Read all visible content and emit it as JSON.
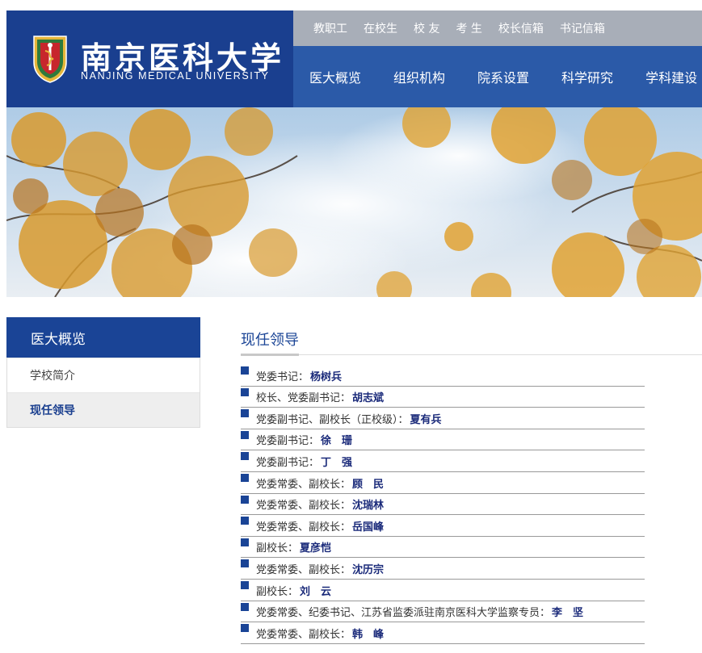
{
  "brand": {
    "name_cn": "南京医科大学",
    "name_en": "NANJING MEDICAL UNIVERSITY"
  },
  "topbar": [
    "教职工",
    "在校生",
    "校 友",
    "考 生",
    "校长信箱",
    "书记信箱"
  ],
  "mainnav": [
    "医大概览",
    "组织机构",
    "院系设置",
    "科学研究",
    "学科建设"
  ],
  "sidebar": {
    "title": "医大概览",
    "items": [
      {
        "label": "学校简介",
        "active": false
      },
      {
        "label": "现任领导",
        "active": true
      }
    ]
  },
  "content": {
    "title": "现任领导",
    "leaders": [
      {
        "title": "党委书记：",
        "name": "杨树兵"
      },
      {
        "title": "校长、党委副书记：",
        "name": "胡志斌"
      },
      {
        "title": "党委副书记、副校长（正校级）：",
        "name": "夏有兵"
      },
      {
        "title": "党委副书记：",
        "name": "徐　珊"
      },
      {
        "title": "党委副书记：",
        "name": "丁　强"
      },
      {
        "title": "党委常委、副校长：",
        "name": "顾　民"
      },
      {
        "title": "党委常委、副校长：",
        "name": "沈瑞林"
      },
      {
        "title": "党委常委、副校长：",
        "name": "岳国峰"
      },
      {
        "title": "副校长：",
        "name": "夏彦恺"
      },
      {
        "title": "党委常委、副校长：",
        "name": "沈历宗"
      },
      {
        "title": "副校长：",
        "name": "刘　云"
      },
      {
        "title": "党委常委、纪委书记、江苏省监委派驻南京医科大学监察专员：",
        "name": "李　坚"
      },
      {
        "title": "党委常委、副校长：",
        "name": "韩　峰"
      }
    ]
  },
  "colors": {
    "header_blue": "#1a3f8f",
    "nav_blue": "#2b5aa8",
    "topbar_gray": "#a8aeb8",
    "sidebar_blue": "#1a4496",
    "name_blue": "#1a2a7a"
  },
  "icons": {
    "seal": "university-seal-icon",
    "bullet": "square-bullet-icon"
  }
}
